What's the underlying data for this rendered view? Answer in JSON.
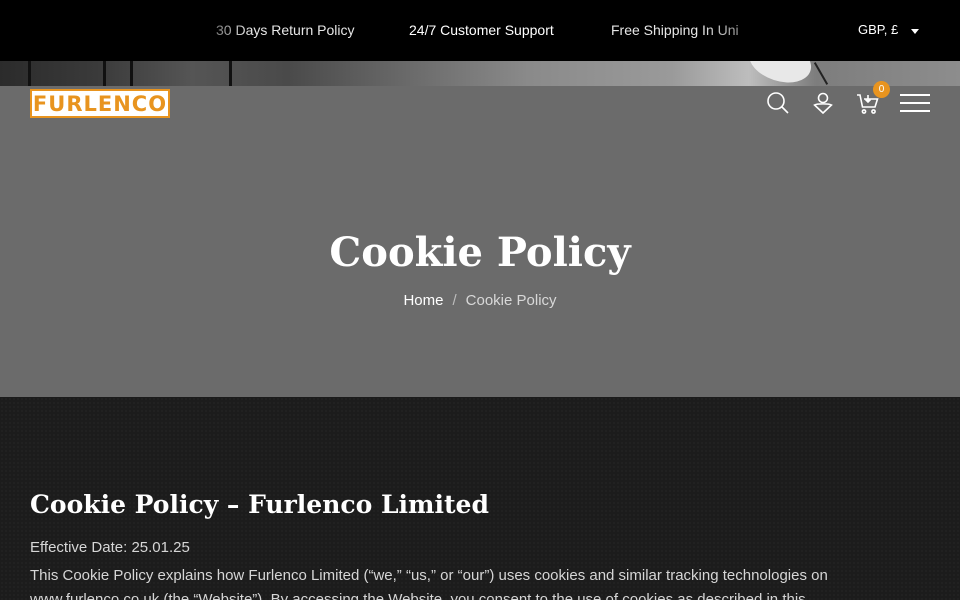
{
  "topbar": {
    "announcements": [
      "30 Days Return Policy",
      "24/7 Customer Support",
      "Free Shipping In Uni"
    ],
    "currency": "GBP, £"
  },
  "header": {
    "logo_text": "FURLENCO",
    "cart_count": "0",
    "icons": [
      "search-icon",
      "user-icon",
      "cart-icon",
      "menu-icon"
    ]
  },
  "hero": {
    "title": "Cookie Policy",
    "breadcrumb": {
      "home": "Home",
      "separator": "/",
      "current": "Cookie Policy"
    }
  },
  "content": {
    "title": "Cookie Policy – Furlenco Limited",
    "effective_date": "Effective Date: 25.01.25",
    "intro": "This Cookie Policy explains how Furlenco Limited (“we,” “us,” or “our”) uses cookies and similar tracking technologies on www.furlenco.co.uk (the “Website”). By accessing the Website, you consent to the use of cookies as described in this"
  },
  "colors": {
    "accent": "#e8941f",
    "topbar_bg": "#000000",
    "hero_overlay": "#6b6b6b",
    "content_bg": "#1c1c1c"
  }
}
